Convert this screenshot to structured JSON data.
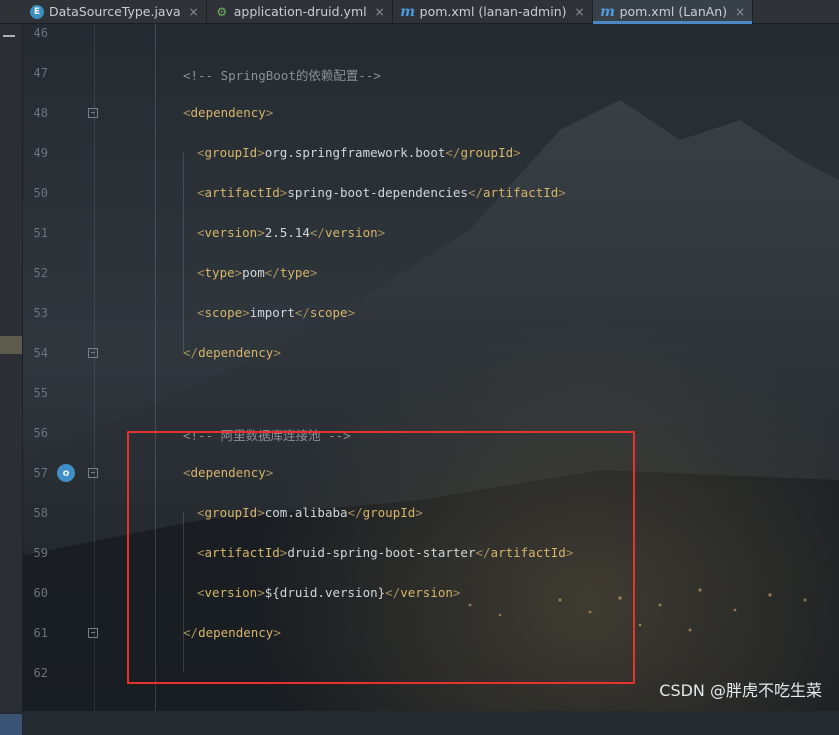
{
  "tabs": [
    {
      "label": "DataSourceType.java",
      "icon": "java-enum-icon",
      "active": false
    },
    {
      "label": "application-druid.yml",
      "icon": "spring-leaf-icon",
      "active": false
    },
    {
      "label": "pom.xml (lanan-admin)",
      "icon": "maven-icon",
      "active": false
    },
    {
      "label": "pom.xml (LanAn)",
      "icon": "maven-icon",
      "active": true
    }
  ],
  "close_glyph": "×",
  "lines": [
    {
      "no": "46",
      "indent": 0,
      "parts": []
    },
    {
      "no": "47",
      "indent": 2,
      "parts": [
        {
          "t": "comment",
          "v": "<!-- SpringBoot的依赖配置-->"
        }
      ]
    },
    {
      "no": "48",
      "indent": 2,
      "fold": true,
      "parts": [
        {
          "t": "b",
          "v": "<"
        },
        {
          "t": "tag",
          "v": "dependency"
        },
        {
          "t": "b",
          "v": ">"
        }
      ]
    },
    {
      "no": "49",
      "indent": 3,
      "parts": [
        {
          "t": "b",
          "v": "<"
        },
        {
          "t": "tag",
          "v": "groupId"
        },
        {
          "t": "b",
          "v": ">"
        },
        {
          "t": "text",
          "v": "org.springframework.boot"
        },
        {
          "t": "b",
          "v": "</"
        },
        {
          "t": "tag",
          "v": "groupId"
        },
        {
          "t": "b",
          "v": ">"
        }
      ]
    },
    {
      "no": "50",
      "indent": 3,
      "parts": [
        {
          "t": "b",
          "v": "<"
        },
        {
          "t": "tag",
          "v": "artifactId"
        },
        {
          "t": "b",
          "v": ">"
        },
        {
          "t": "text",
          "v": "spring-boot-dependencies"
        },
        {
          "t": "b",
          "v": "</"
        },
        {
          "t": "tag",
          "v": "artifactId"
        },
        {
          "t": "b",
          "v": ">"
        }
      ]
    },
    {
      "no": "51",
      "indent": 3,
      "parts": [
        {
          "t": "b",
          "v": "<"
        },
        {
          "t": "tag",
          "v": "version"
        },
        {
          "t": "b",
          "v": ">"
        },
        {
          "t": "text",
          "v": "2.5.14"
        },
        {
          "t": "b",
          "v": "</"
        },
        {
          "t": "tag",
          "v": "version"
        },
        {
          "t": "b",
          "v": ">"
        }
      ]
    },
    {
      "no": "52",
      "indent": 3,
      "parts": [
        {
          "t": "b",
          "v": "<"
        },
        {
          "t": "tag",
          "v": "type"
        },
        {
          "t": "b",
          "v": ">"
        },
        {
          "t": "text",
          "v": "pom"
        },
        {
          "t": "b",
          "v": "</"
        },
        {
          "t": "tag",
          "v": "type"
        },
        {
          "t": "b",
          "v": ">"
        }
      ]
    },
    {
      "no": "53",
      "indent": 3,
      "parts": [
        {
          "t": "b",
          "v": "<"
        },
        {
          "t": "tag",
          "v": "scope"
        },
        {
          "t": "b",
          "v": ">"
        },
        {
          "t": "text",
          "v": "import"
        },
        {
          "t": "b",
          "v": "</"
        },
        {
          "t": "tag",
          "v": "scope"
        },
        {
          "t": "b",
          "v": ">"
        }
      ]
    },
    {
      "no": "54",
      "indent": 2,
      "fold": true,
      "parts": [
        {
          "t": "b",
          "v": "</"
        },
        {
          "t": "tag",
          "v": "dependency"
        },
        {
          "t": "b",
          "v": ">"
        }
      ]
    },
    {
      "no": "55",
      "indent": 0,
      "parts": []
    },
    {
      "no": "56",
      "indent": 2,
      "parts": [
        {
          "t": "comment",
          "v": "<!-- 阿里数据库连接池 -->"
        }
      ]
    },
    {
      "no": "57",
      "indent": 2,
      "fold": true,
      "gutter_icon": "maven-dependency-icon",
      "parts": [
        {
          "t": "b",
          "v": "<"
        },
        {
          "t": "tag",
          "v": "dependency"
        },
        {
          "t": "b",
          "v": ">"
        }
      ]
    },
    {
      "no": "58",
      "indent": 3,
      "parts": [
        {
          "t": "b",
          "v": "<"
        },
        {
          "t": "tag",
          "v": "groupId"
        },
        {
          "t": "b",
          "v": ">"
        },
        {
          "t": "text",
          "v": "com.alibaba"
        },
        {
          "t": "b",
          "v": "</"
        },
        {
          "t": "tag",
          "v": "groupId"
        },
        {
          "t": "b",
          "v": ">"
        }
      ]
    },
    {
      "no": "59",
      "indent": 3,
      "parts": [
        {
          "t": "b",
          "v": "<"
        },
        {
          "t": "tag",
          "v": "artifactId"
        },
        {
          "t": "b",
          "v": ">"
        },
        {
          "t": "text",
          "v": "druid-spring-boot-starter"
        },
        {
          "t": "b",
          "v": "</"
        },
        {
          "t": "tag",
          "v": "artifactId"
        },
        {
          "t": "b",
          "v": ">"
        }
      ]
    },
    {
      "no": "60",
      "indent": 3,
      "parts": [
        {
          "t": "b",
          "v": "<"
        },
        {
          "t": "tag",
          "v": "version"
        },
        {
          "t": "b",
          "v": ">"
        },
        {
          "t": "text",
          "v": "${druid.version}"
        },
        {
          "t": "b",
          "v": "</"
        },
        {
          "t": "tag",
          "v": "version"
        },
        {
          "t": "b",
          "v": ">"
        }
      ]
    },
    {
      "no": "61",
      "indent": 2,
      "fold": true,
      "parts": [
        {
          "t": "b",
          "v": "</"
        },
        {
          "t": "tag",
          "v": "dependency"
        },
        {
          "t": "b",
          "v": ">"
        }
      ]
    },
    {
      "no": "62",
      "indent": 0,
      "parts": []
    }
  ],
  "colors": {
    "comment": "#8b9096",
    "tag": "#d7b56a",
    "bracket": "#a89060",
    "text": "#d2d6da",
    "highlight": "#e5322d",
    "active_tab_underline": "#4a88c7"
  },
  "watermark": "CSDN @胖虎不吃生菜"
}
